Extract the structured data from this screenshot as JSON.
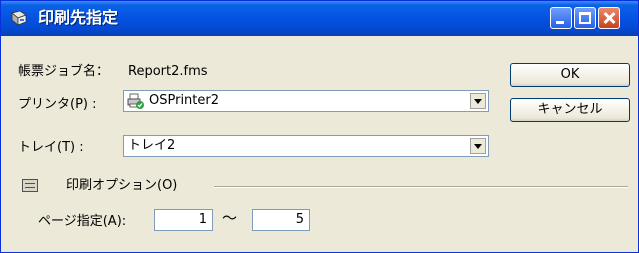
{
  "window": {
    "title": "印刷先指定"
  },
  "form": {
    "report_name_label": "帳票ジョブ名：",
    "report_name_value": "Report2.fms",
    "printer_label": "プリンタ(P) :",
    "printer_value": "OSPrinter2",
    "tray_label": "トレイ(T) :",
    "tray_value": "トレイ2",
    "print_options_label": "印刷オプション(O)",
    "page_range_label": "ページ指定(A):",
    "page_from": "1",
    "page_to": "5",
    "range_separator": "～"
  },
  "buttons": {
    "ok_label": "OK",
    "cancel_label": "キャンセル"
  },
  "colors": {
    "title_bar": "#0554e4",
    "dialog_bg": "#ece9d8",
    "close_button": "#c9401e"
  }
}
